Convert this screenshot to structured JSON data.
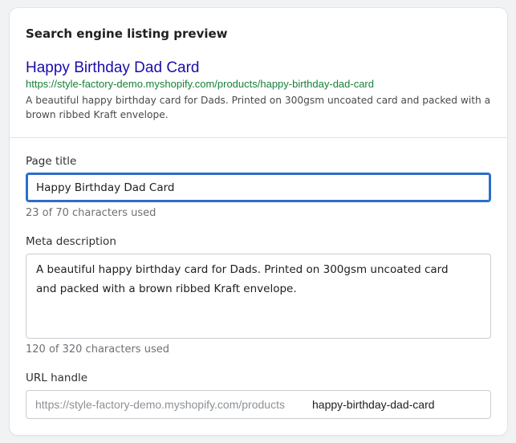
{
  "preview": {
    "section_title": "Search engine listing preview",
    "serp_title": "Happy Birthday Dad Card",
    "serp_url": "https://style-factory-demo.myshopify.com/products/happy-birthday-dad-card",
    "serp_description": "A beautiful happy birthday card for Dads. Printed on 300gsm uncoated card and packed with a brown ribbed Kraft envelope."
  },
  "page_title_field": {
    "label": "Page title",
    "value": "Happy Birthday Dad Card",
    "help": "23 of 70 characters used"
  },
  "meta_description_field": {
    "label": "Meta description",
    "value": "A beautiful happy birthday card for Dads. Printed on 300gsm uncoated card and packed with a brown ribbed Kraft envelope.",
    "help": "120 of 320 characters used"
  },
  "url_handle_field": {
    "label": "URL handle",
    "prefix": "https://style-factory-demo.myshopify.com/products",
    "value": "happy-birthday-dad-card"
  },
  "colors": {
    "serp_title": "#1a0dab",
    "serp_url": "#188038",
    "focus_ring": "#2c6ecb"
  }
}
